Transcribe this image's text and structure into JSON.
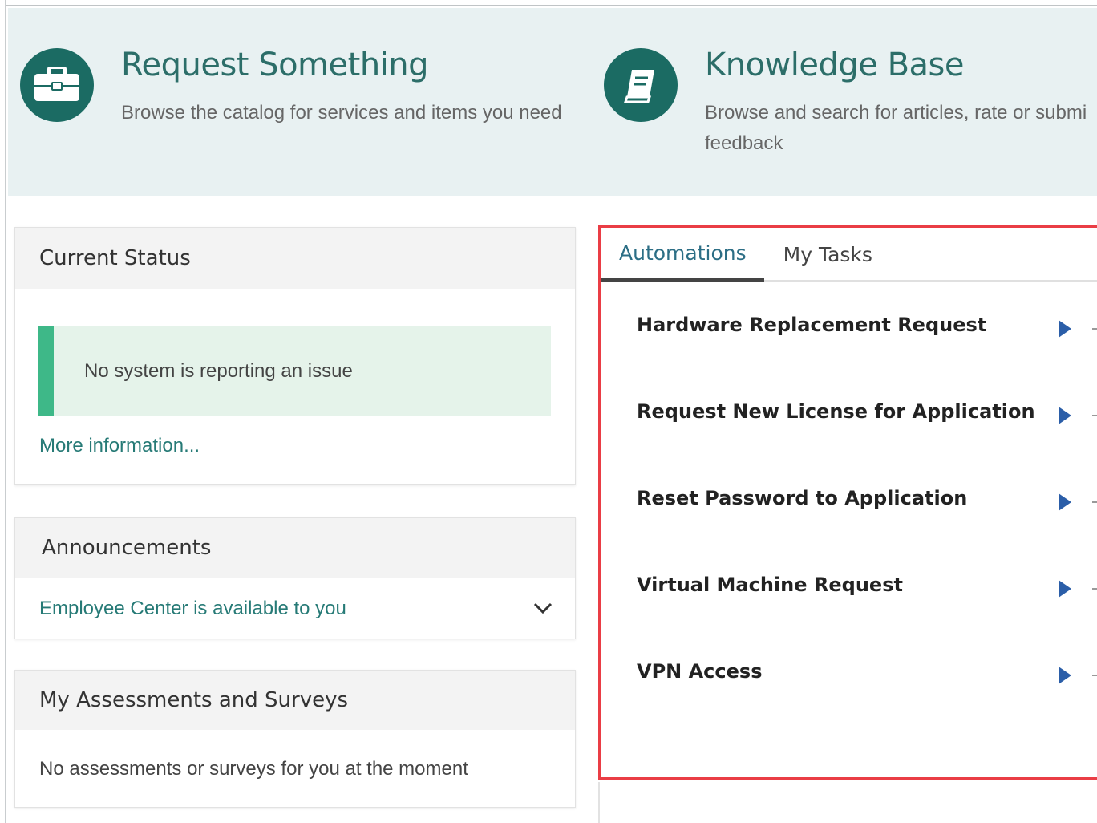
{
  "hero": {
    "request": {
      "title": "Request Something",
      "description": "Browse the catalog for services and items you need",
      "icon": "briefcase-icon"
    },
    "knowledge": {
      "title": "Knowledge Base",
      "description_line1": "Browse and search for articles, rate or submi",
      "description_line2": "feedback",
      "icon": "book-icon"
    }
  },
  "current_status": {
    "title": "Current Status",
    "message": "No system is reporting an issue",
    "link": "More information..."
  },
  "announcements": {
    "title": "Announcements",
    "item": "Employee Center is available to you",
    "icon": "chevron-down-icon"
  },
  "assessments": {
    "title": "My Assessments and Surveys",
    "message": "No assessments or surveys for you at the moment"
  },
  "panel": {
    "tabs": [
      {
        "label": "Automations"
      },
      {
        "label": "My Tasks"
      }
    ],
    "items": [
      {
        "label": "Hardware Replacement Request"
      },
      {
        "label": "Request New License for Application"
      },
      {
        "label": "Reset Password to Application"
      },
      {
        "label": "Virtual Machine Request"
      },
      {
        "label": "VPN Access"
      }
    ]
  },
  "colors": {
    "brand_teal": "#1b6b63",
    "link": "#267a76",
    "status_green": "#3eb888",
    "highlight_border": "#ea3d45",
    "arrow_blue": "#2b5ea8"
  }
}
